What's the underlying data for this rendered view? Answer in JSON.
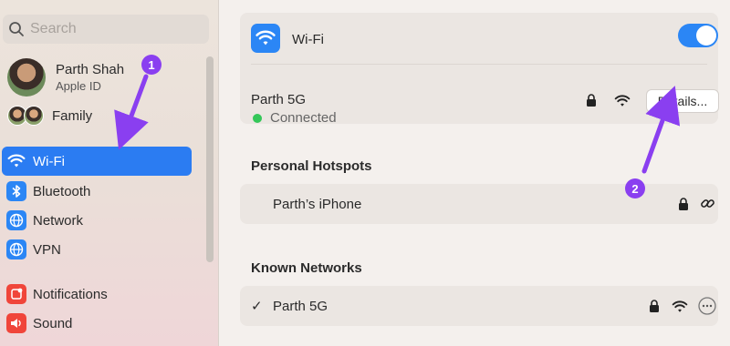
{
  "search": {
    "placeholder": "Search"
  },
  "profile": {
    "name": "Parth Shah",
    "subtitle": "Apple ID"
  },
  "family": {
    "label": "Family"
  },
  "sidebar": {
    "items": [
      {
        "label": "Wi-Fi",
        "icon": "wifi-icon",
        "color": "#2b86f5",
        "active": true
      },
      {
        "label": "Bluetooth",
        "icon": "bluetooth-icon",
        "color": "#2b86f5"
      },
      {
        "label": "Network",
        "icon": "globe-icon",
        "color": "#2b86f5"
      },
      {
        "label": "VPN",
        "icon": "globe-icon",
        "color": "#2b86f5"
      },
      {
        "label": "Notifications",
        "icon": "bell-icon",
        "color": "#f0453a"
      },
      {
        "label": "Sound",
        "icon": "speaker-icon",
        "color": "#f0453a"
      }
    ]
  },
  "wifi": {
    "title": "Wi-Fi",
    "enabled": true,
    "current_network": "Parth 5G",
    "status": "Connected",
    "details_label": "Details..."
  },
  "hotspots": {
    "title": "Personal Hotspots",
    "items": [
      {
        "name": "Parth’s iPhone"
      }
    ]
  },
  "known": {
    "title": "Known Networks",
    "items": [
      {
        "name": "Parth 5G",
        "checked": true
      }
    ]
  },
  "annotations": [
    {
      "label": "1"
    },
    {
      "label": "2"
    }
  ],
  "colors": {
    "accent": "#2b86f5",
    "annotation": "#8a3ff0",
    "connected": "#34c759"
  }
}
